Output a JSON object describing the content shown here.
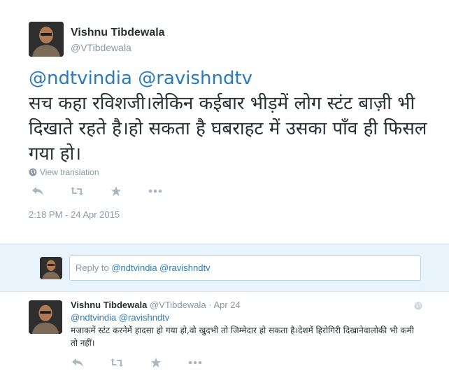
{
  "main_tweet": {
    "author_name": "Vishnu Tibdewala",
    "author_handle": "@VTibdewala",
    "mentions": [
      "@ndtvindia",
      "@ravishndtv"
    ],
    "text": "सच कहा रविशजी।लेकिन कईबार भीड़में लोग स्टंट बाज़ी भी दिखाते रहते है।हो सकता है घबराहट में उसका पाँव ही फिसल गया हो।",
    "view_translation": "View translation",
    "timestamp": "2:18 PM - 24 Apr 2015",
    "actions": [
      "reply-icon",
      "retweet-icon",
      "favorite-icon",
      "more-icon"
    ]
  },
  "reply_box": {
    "prefix": "Reply to ",
    "mentions": "@ndtvindia @ravishndtv"
  },
  "reply_tweet": {
    "author_name": "Vishnu Tibdewala",
    "author_handle": "@VTibdewala",
    "separator": "·",
    "date": "Apr 24",
    "mentions": "@ndtvindia @ravishndtv",
    "text": "मजाकमें स्टंट करनेमें हादसा हो गया हो,वो खुदभी तो जिम्मेदार हो सकता है।देशमें हिरोगिरी दिखानेवालोकी भी कमी तो नहीं।"
  },
  "colors": {
    "link": "#2b7bb9",
    "muted": "#8899a6",
    "reply_bg": "#e8f3fb"
  }
}
